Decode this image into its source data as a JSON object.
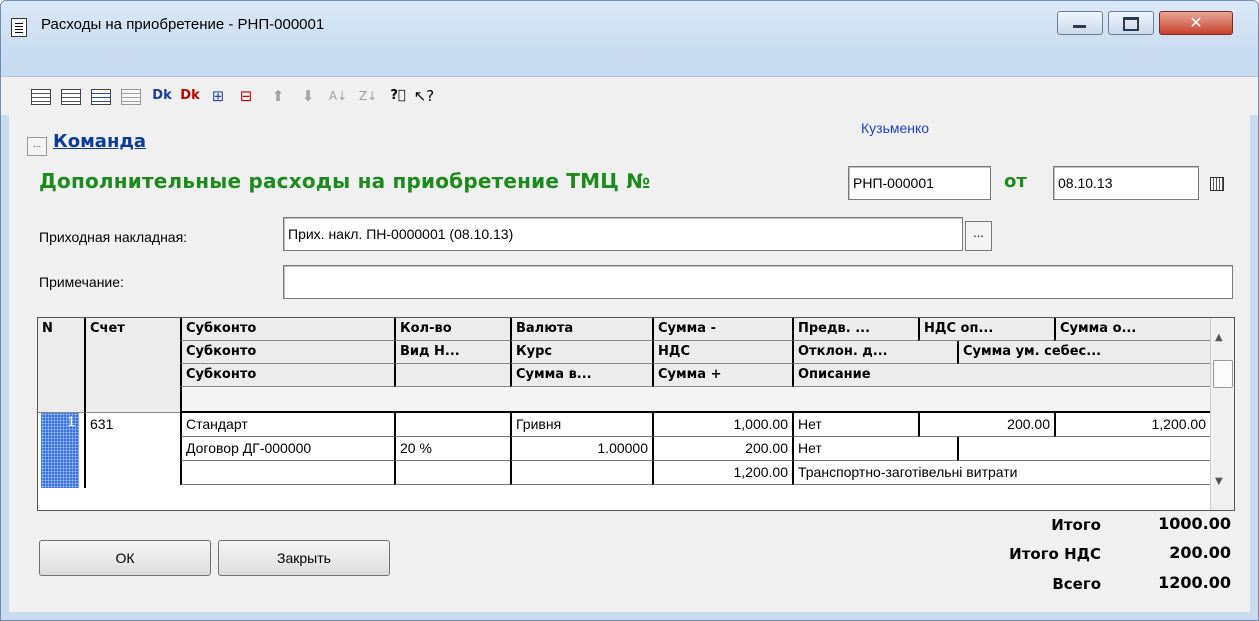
{
  "window": {
    "title": "Расходы на приобретение - РНП-000001"
  },
  "toolbar": {
    "icons": [
      "add-row-icon",
      "add-row-below-icon",
      "delete-row-icon",
      "copy-row-icon",
      "debit-credit-icon",
      "debit-credit-alt-icon",
      "insert-column-icon",
      "column-settings-icon",
      "move-up-icon",
      "move-down-icon",
      "sort-asc-icon",
      "sort-desc-icon",
      "help-icon",
      "whats-this-icon"
    ]
  },
  "form": {
    "command_link": "Команда",
    "author": "Кузьменко",
    "heading": "Дополнительные расходы на приобретение ТМЦ №",
    "doc_number": "РНП-000001",
    "date_label": "от",
    "date": "08.10.13",
    "invoice_label": "Приходная накладная:",
    "invoice_value": "Прих. накл. ПН-0000001 (08.10.13)",
    "note_label": "Примечание:",
    "note_value": ""
  },
  "grid": {
    "headers": {
      "n": "N",
      "account": "Счет",
      "subconto1": "Субконто",
      "subconto2": "Субконто",
      "subconto3": "Субконто",
      "qty": "Кол-во",
      "vat_type": "Вид Н...",
      "currency": "Валюта",
      "rate": "Курс",
      "amount_val": "Сумма в...",
      "sum_minus": "Сумма -",
      "vat": "НДС",
      "sum_plus": "Сумма +",
      "prepay": "Предв. ...",
      "vat_op": "НДС оп...",
      "sum_o": "Сумма о...",
      "deviation": "Отклон. д...",
      "sum_cost": "Сумма ум. себес...",
      "description": "Описание"
    },
    "row": {
      "n": "1",
      "account": "631",
      "subconto1": "Стандарт",
      "subconto2": "Договор ДГ-000000",
      "subconto3": "",
      "qty": "",
      "vat_type": "20 %",
      "currency": "Гривня",
      "rate": "1.00000",
      "amount_val": "",
      "sum_minus": "1,000.00",
      "vat": "200.00",
      "sum_plus": "1,200.00",
      "prepay": "Нет",
      "vat_op": "200.00",
      "sum_o": "1,200.00",
      "deviation": "Нет",
      "sum_cost": "",
      "description": "Транспортно-заготівельні витрати"
    }
  },
  "totals": {
    "total_label": "Итого",
    "total_value": "1000.00",
    "vat_label": "Итого НДС",
    "vat_value": "200.00",
    "all_label": "Всего",
    "all_value": "1200.00"
  },
  "buttons": {
    "ok": "ОК",
    "close": "Закрыть"
  }
}
